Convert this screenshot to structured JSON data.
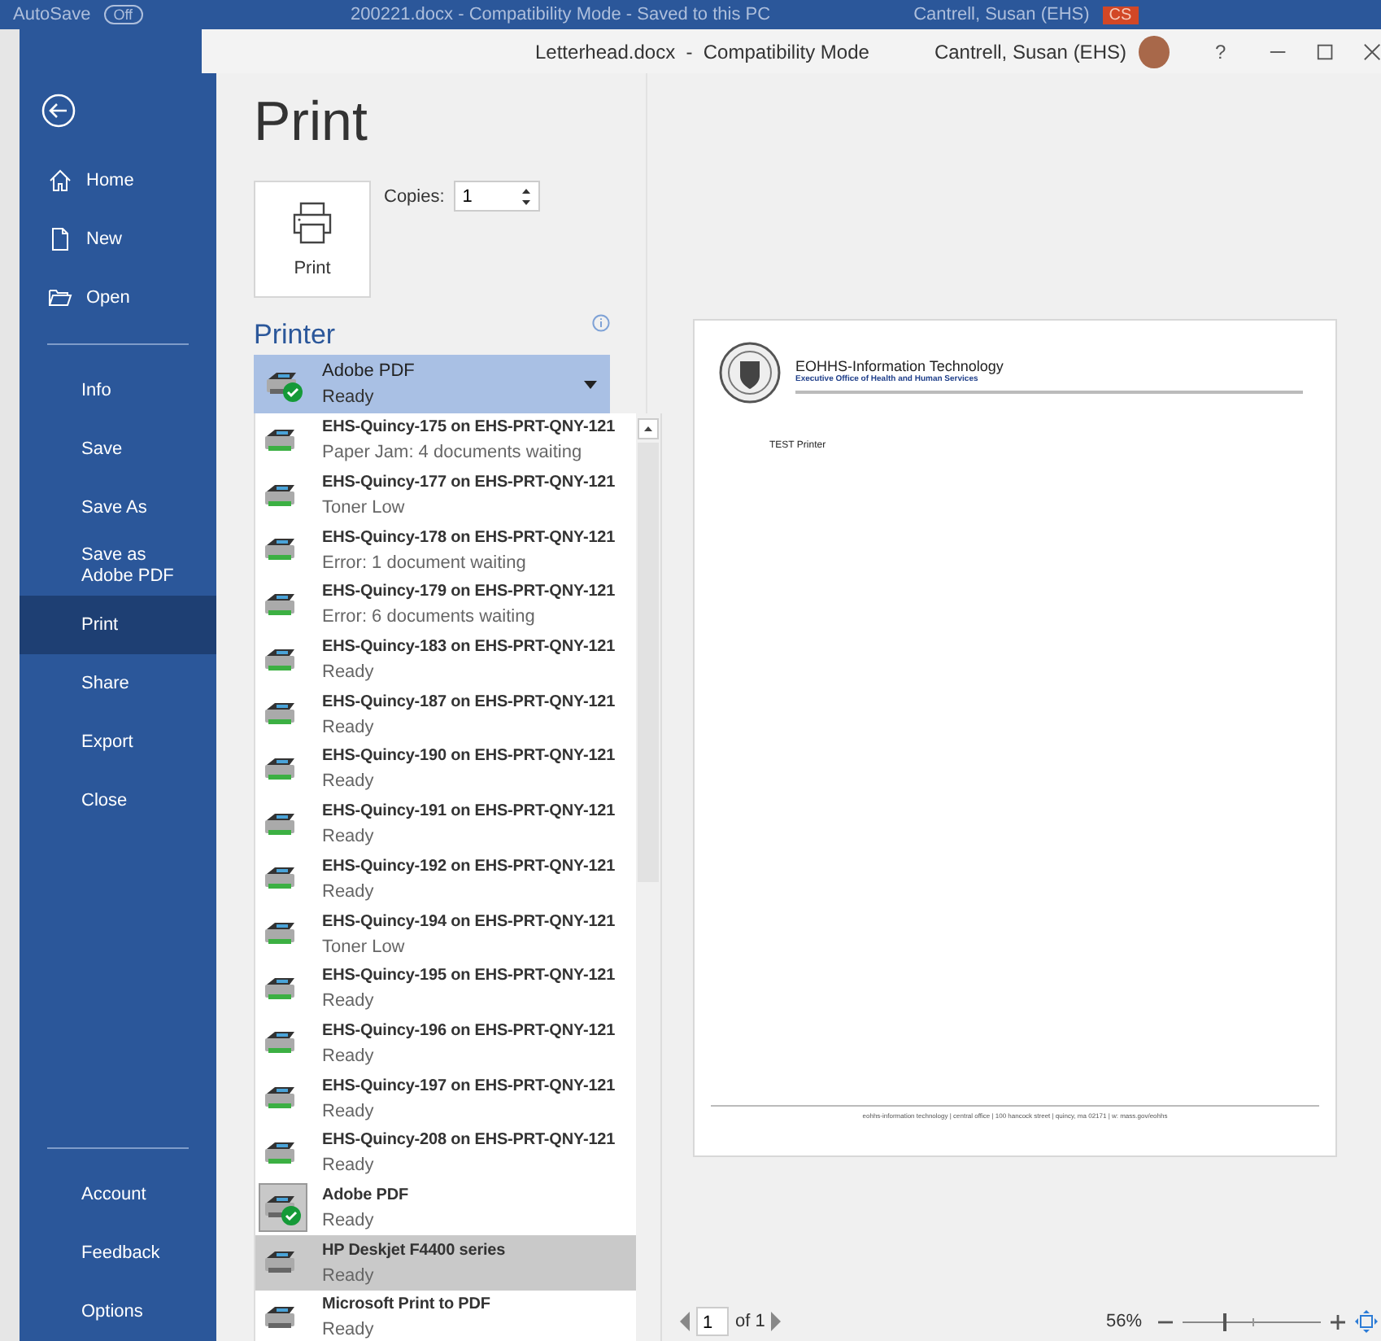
{
  "background_window": {
    "autosave_label": "AutoSave",
    "autosave_state": "Off",
    "title": "200221.docx  -  Compatibility Mode  -  Saved to this PC",
    "user": "Cantrell, Susan (EHS)",
    "user_initials": "CS"
  },
  "window": {
    "title": "Letterhead.docx  -  Compatibility Mode",
    "user": "Cantrell, Susan (EHS)",
    "help": "?"
  },
  "sidebar": {
    "nav_items": [
      {
        "label": "Home",
        "selected": false
      },
      {
        "label": "New",
        "selected": false
      },
      {
        "label": "Open",
        "selected": false
      }
    ],
    "items": [
      {
        "label": "Info",
        "selected": false
      },
      {
        "label": "Save",
        "selected": false
      },
      {
        "label": "Save As",
        "selected": false
      },
      {
        "label": "Save as Adobe PDF",
        "selected": false
      },
      {
        "label": "Print",
        "selected": true
      },
      {
        "label": "Share",
        "selected": false
      },
      {
        "label": "Export",
        "selected": false
      },
      {
        "label": "Close",
        "selected": false
      }
    ],
    "footer_items": [
      {
        "label": "Account",
        "selected": false
      },
      {
        "label": "Feedback",
        "selected": false
      },
      {
        "label": "Options",
        "selected": false
      }
    ]
  },
  "title": "Print",
  "print_button": {
    "label": "Print"
  },
  "copies": {
    "label": "Copies:",
    "value": "1"
  },
  "printer": {
    "heading": "Printer",
    "current": {
      "name": "Adobe PDF",
      "status": "Ready",
      "default": true
    },
    "options": [
      {
        "name": "EHS-Quincy-175 on EHS-PRT-QNY-121",
        "status": "Paper Jam: 4 documents waiting",
        "kind": "network",
        "default": false,
        "selected": false
      },
      {
        "name": "EHS-Quincy-177 on EHS-PRT-QNY-121",
        "status": "Toner Low",
        "kind": "network",
        "default": false,
        "selected": false
      },
      {
        "name": "EHS-Quincy-178 on EHS-PRT-QNY-121",
        "status": "Error: 1 document waiting",
        "kind": "network",
        "default": false,
        "selected": false
      },
      {
        "name": "EHS-Quincy-179 on EHS-PRT-QNY-121",
        "status": "Error: 6 documents waiting",
        "kind": "network",
        "default": false,
        "selected": false
      },
      {
        "name": "EHS-Quincy-183 on EHS-PRT-QNY-121",
        "status": "Ready",
        "kind": "network",
        "default": false,
        "selected": false
      },
      {
        "name": "EHS-Quincy-187 on EHS-PRT-QNY-121",
        "status": "Ready",
        "kind": "network",
        "default": false,
        "selected": false
      },
      {
        "name": "EHS-Quincy-190 on EHS-PRT-QNY-121",
        "status": "Ready",
        "kind": "network",
        "default": false,
        "selected": false
      },
      {
        "name": "EHS-Quincy-191 on EHS-PRT-QNY-121",
        "status": "Ready",
        "kind": "network",
        "default": false,
        "selected": false
      },
      {
        "name": "EHS-Quincy-192 on EHS-PRT-QNY-121",
        "status": "Ready",
        "kind": "network",
        "default": false,
        "selected": false
      },
      {
        "name": "EHS-Quincy-194 on EHS-PRT-QNY-121",
        "status": "Toner Low",
        "kind": "network",
        "default": false,
        "selected": false
      },
      {
        "name": "EHS-Quincy-195 on EHS-PRT-QNY-121",
        "status": "Ready",
        "kind": "network",
        "default": false,
        "selected": false
      },
      {
        "name": "EHS-Quincy-196 on EHS-PRT-QNY-121",
        "status": "Ready",
        "kind": "network",
        "default": false,
        "selected": false
      },
      {
        "name": "EHS-Quincy-197 on EHS-PRT-QNY-121",
        "status": "Ready",
        "kind": "network",
        "default": false,
        "selected": false
      },
      {
        "name": "EHS-Quincy-208 on EHS-PRT-QNY-121",
        "status": "Ready",
        "kind": "network",
        "default": false,
        "selected": false
      },
      {
        "name": "Adobe PDF",
        "status": "Ready",
        "kind": "local",
        "default": true,
        "selected": false
      },
      {
        "name": "HP Deskjet F4400 series",
        "status": "Ready",
        "kind": "local",
        "default": false,
        "selected": true
      },
      {
        "name": "Microsoft Print to PDF",
        "status": "Ready",
        "kind": "local",
        "default": false,
        "selected": false
      }
    ]
  },
  "preview": {
    "letterhead_title": "EOHHS-Information Technology",
    "letterhead_subtitle": "Executive Office of Health and Human Services",
    "body": "TEST Printer",
    "footer": "eohhs-information technology | central office | 100 hancock street | quincy, ma 02171 | w: mass.gov/eohhs"
  },
  "page_nav": {
    "page": "1",
    "total": "of 1"
  },
  "zoom": {
    "percent": "56%",
    "level": 0.3
  }
}
